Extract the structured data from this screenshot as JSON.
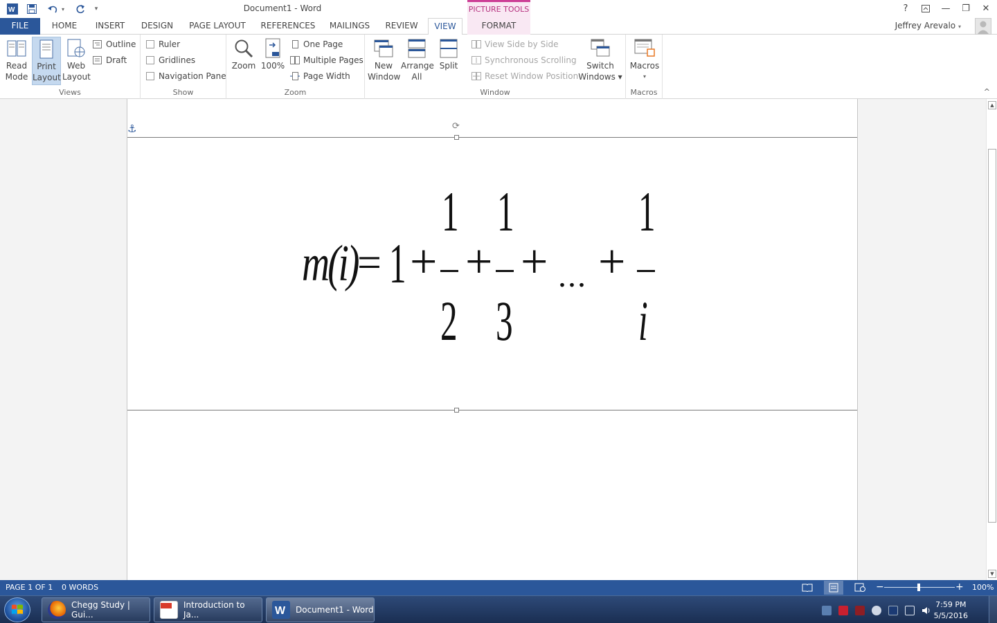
{
  "window": {
    "title": "Document1 - Word",
    "context_tab_group": "PICTURE TOOLS",
    "help": "?",
    "ribbon_display": "⊼",
    "minimize": "—",
    "restore": "❐",
    "close": "✕"
  },
  "qat": {
    "app_icon": "word-icon",
    "save_icon": "save-icon",
    "undo_icon": "undo-icon",
    "redo_icon": "redo-icon",
    "customize_icon": "customize-qat-icon"
  },
  "tabs": [
    {
      "label": "FILE"
    },
    {
      "label": "HOME"
    },
    {
      "label": "INSERT"
    },
    {
      "label": "DESIGN"
    },
    {
      "label": "PAGE LAYOUT"
    },
    {
      "label": "REFERENCES"
    },
    {
      "label": "MAILINGS"
    },
    {
      "label": "REVIEW"
    },
    {
      "label": "VIEW"
    },
    {
      "label": "FORMAT"
    }
  ],
  "user": {
    "name": "Jeffrey Arevalo"
  },
  "ribbon": {
    "views": {
      "label": "Views",
      "read_mode": [
        "Read",
        "Mode"
      ],
      "print_layout": [
        "Print",
        "Layout"
      ],
      "web_layout": [
        "Web",
        "Layout"
      ],
      "outline": "Outline",
      "draft": "Draft"
    },
    "show": {
      "label": "Show",
      "ruler": "Ruler",
      "gridlines": "Gridlines",
      "navigation_pane": "Navigation Pane"
    },
    "zoom": {
      "label": "Zoom",
      "zoom": "Zoom",
      "hundred": "100%",
      "one_page": "One Page",
      "multiple_pages": "Multiple Pages",
      "page_width": "Page Width"
    },
    "window": {
      "label": "Window",
      "new_window": [
        "New",
        "Window"
      ],
      "arrange_all": [
        "Arrange",
        "All"
      ],
      "split": "Split",
      "view_side_by_side": "View Side by Side",
      "synchronous_scrolling": "Synchronous Scrolling",
      "reset_window_position": "Reset Window Position",
      "switch_windows": [
        "Switch",
        "Windows ▾"
      ]
    },
    "macros": {
      "label": "Macros",
      "macros": "Macros",
      "dropdown": "▾"
    },
    "collapse": "^"
  },
  "formula": {
    "lhs": "m(i)",
    "equals": "=",
    "one": "1",
    "plus": "+",
    "numerator_1": "1",
    "denominator_1": "2",
    "numerator_2": "1",
    "denominator_2": "3",
    "ellipsis": "...",
    "numerator_3": "1",
    "denominator_3": "i"
  },
  "status": {
    "page": "PAGE 1 OF 1",
    "words": "0 WORDS",
    "zoom_minus": "−",
    "zoom_plus": "+",
    "zoom_level": "100%"
  },
  "taskbar": {
    "items": [
      {
        "label": "Chegg Study | Gui..."
      },
      {
        "label": "Introduction to Ja..."
      },
      {
        "label": "Document1 - Word"
      }
    ],
    "time": "7:59 PM",
    "date": "5/5/2016"
  }
}
